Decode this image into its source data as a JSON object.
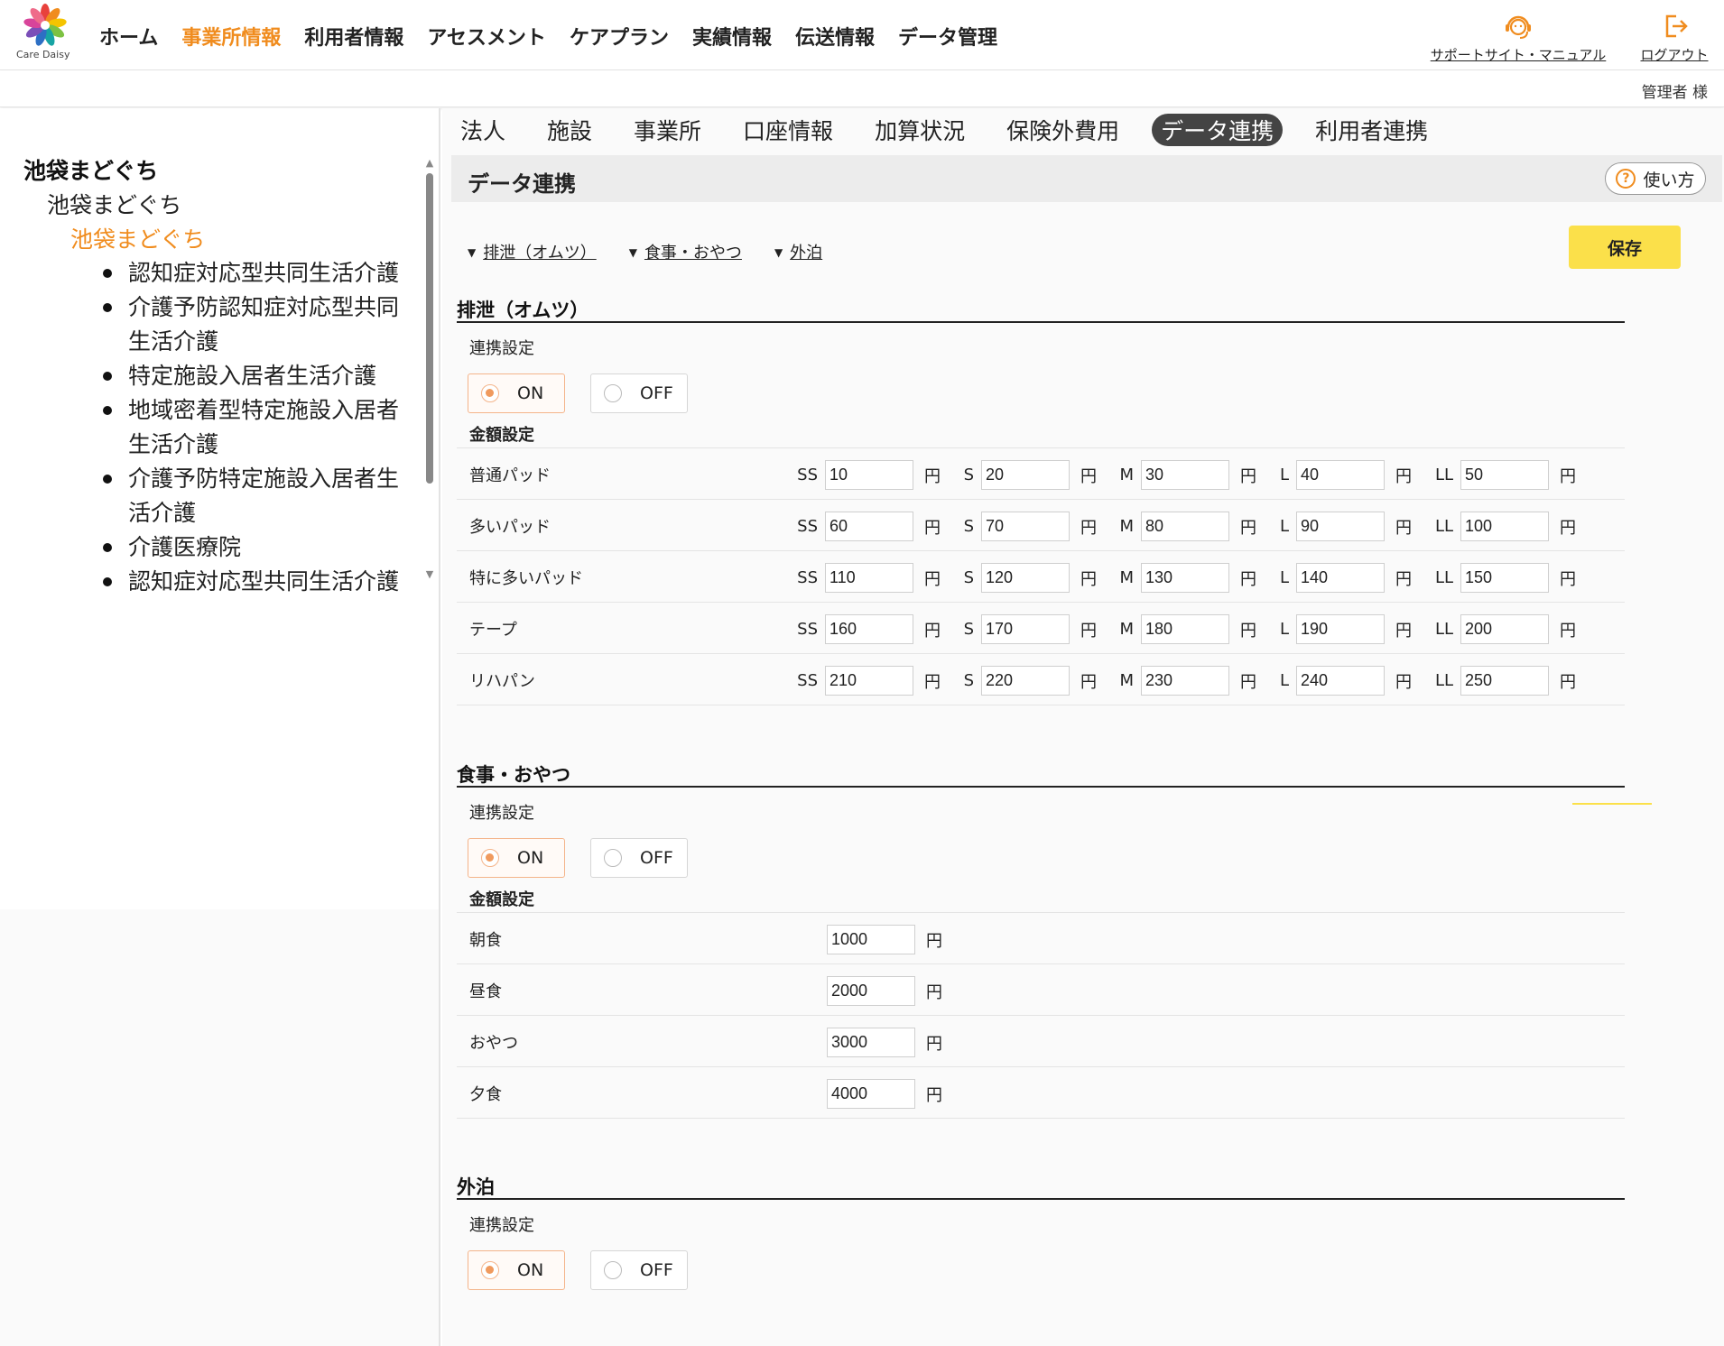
{
  "brand": {
    "logo_text": "Care Daisy",
    "accent": "#f08c1e",
    "save_color": "#fbe04a"
  },
  "nav": {
    "items": [
      {
        "label": "ホーム",
        "active": false
      },
      {
        "label": "事業所情報",
        "active": true
      },
      {
        "label": "利用者情報",
        "active": false
      },
      {
        "label": "アセスメント",
        "active": false
      },
      {
        "label": "ケアプラン",
        "active": false
      },
      {
        "label": "実績情報",
        "active": false
      },
      {
        "label": "伝送情報",
        "active": false
      },
      {
        "label": "データ管理",
        "active": false
      }
    ],
    "support_label": "サポートサイト・マニュアル",
    "support_icon": "headset-icon",
    "logout_label": "ログアウト",
    "logout_icon": "logout-icon",
    "user": "管理者 様"
  },
  "sidebar": {
    "level1": "池袋まどぐち",
    "level2": "池袋まどぐち",
    "level3": "池袋まどぐち",
    "services": [
      "認知症対応型共同生活介護",
      "介護予防認知症対応型共同生活介護",
      "特定施設入居者生活介護",
      "地域密着型特定施設入居者生活介護",
      "介護予防特定施設入居者生活介護",
      "介護医療院",
      "認知症対応型共同生活介護"
    ]
  },
  "subtabs": [
    {
      "label": "法人",
      "active": false
    },
    {
      "label": "施設",
      "active": false
    },
    {
      "label": "事業所",
      "active": false
    },
    {
      "label": "口座情報",
      "active": false
    },
    {
      "label": "加算状況",
      "active": false
    },
    {
      "label": "保険外費用",
      "active": false
    },
    {
      "label": "データ連携",
      "active": true
    },
    {
      "label": "利用者連携",
      "active": false
    }
  ],
  "page": {
    "title": "データ連携",
    "help_label": "使い方",
    "save_label": "保存"
  },
  "anchors": [
    "排泄（オムツ）",
    "食事・おやつ",
    "外泊"
  ],
  "common": {
    "link_setting": "連携設定",
    "amount_setting": "金額設定",
    "on": "ON",
    "off": "OFF",
    "yen": "円"
  },
  "sections": {
    "diaper": {
      "title": "排泄（オムツ）",
      "selected": "ON",
      "sizes": [
        "SS",
        "S",
        "M",
        "L",
        "LL"
      ],
      "rows": [
        {
          "label": "普通パッド",
          "values": [
            "10",
            "20",
            "30",
            "40",
            "50"
          ]
        },
        {
          "label": "多いパッド",
          "values": [
            "60",
            "70",
            "80",
            "90",
            "100"
          ]
        },
        {
          "label": "特に多いパッド",
          "values": [
            "110",
            "120",
            "130",
            "140",
            "150"
          ]
        },
        {
          "label": "テープ",
          "values": [
            "160",
            "170",
            "180",
            "190",
            "200"
          ]
        },
        {
          "label": "リハパン",
          "values": [
            "210",
            "220",
            "230",
            "240",
            "250"
          ]
        }
      ]
    },
    "meal": {
      "title": "食事・おやつ",
      "selected": "ON",
      "rows": [
        {
          "label": "朝食",
          "value": "1000"
        },
        {
          "label": "昼食",
          "value": "2000"
        },
        {
          "label": "おやつ",
          "value": "3000"
        },
        {
          "label": "夕食",
          "value": "4000"
        }
      ]
    },
    "overnight": {
      "title": "外泊",
      "selected": "ON"
    }
  }
}
